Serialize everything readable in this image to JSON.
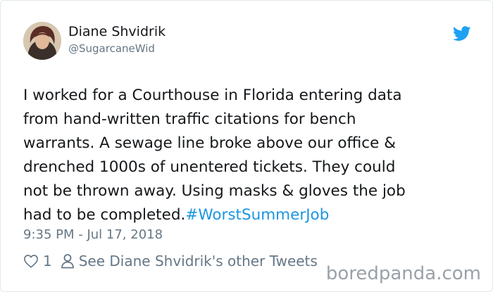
{
  "tweet": {
    "author_name": "Diane Shvidrik",
    "author_handle": "@SugarcaneWid",
    "text_lines": [
      "I worked for a Courthouse in Florida entering data",
      "from hand-written traffic citations for bench",
      "warrants. A sewage line broke above our office &",
      "drenched 1000s of unentered tickets. They could",
      "not be thrown away.  Using masks & gloves the job",
      "had to be completed."
    ],
    "hashtag": "#WorstSummerJob",
    "timestamp": "9:35 PM - Jul 17, 2018",
    "like_count": "1",
    "see_more_label": "See Diane Shvidrik's other Tweets"
  },
  "watermark": "boredpanda.com",
  "icons": {
    "brand": "twitter-bird-icon",
    "like": "heart-icon",
    "profile": "person-icon"
  },
  "colors": {
    "accent": "#1b95e0",
    "muted": "#657786",
    "text": "#14171a"
  }
}
